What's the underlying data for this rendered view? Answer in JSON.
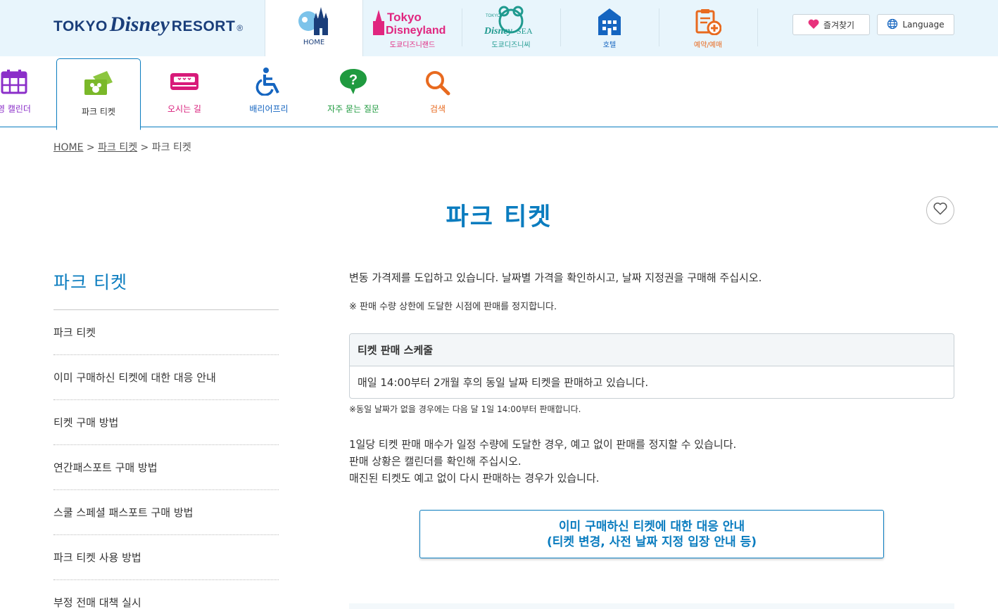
{
  "header": {
    "logo": {
      "part1": "TOKYO",
      "part2": "Disney",
      "part3": "RESORT",
      "reg": "®"
    },
    "park_tabs": [
      {
        "id": "home",
        "label": "HOME",
        "color": "#1a3e7a"
      },
      {
        "id": "land",
        "label": "도쿄디즈니랜드",
        "logo_lines": [
          "Tokyo",
          "Disneyland"
        ],
        "color": "#e0267f"
      },
      {
        "id": "sea",
        "label": "도쿄디즈니씨",
        "logo_small": "TOKYO",
        "logo_lines": [
          "Disney",
          "SEA"
        ],
        "color": "#1f9a8f"
      },
      {
        "id": "hotel",
        "label": "호텔",
        "color": "#1565c0"
      },
      {
        "id": "reserve",
        "label": "예약/예매",
        "color": "#e86a1f"
      }
    ],
    "favorites_label": "즐겨찾기",
    "language_label": "Language"
  },
  "subnav": {
    "items": [
      {
        "id": "calendar",
        "label": "영 캘린더",
        "color": "#8b2fc9"
      },
      {
        "id": "tickets",
        "label": "파크 티켓",
        "color": "#333333"
      },
      {
        "id": "access",
        "label": "오시는 길",
        "color": "#d81b7a"
      },
      {
        "id": "barrierfree",
        "label": "배리어프리",
        "color": "#1565c0"
      },
      {
        "id": "faq",
        "label": "자주 묻는 질문",
        "color": "#1f9a3f"
      },
      {
        "id": "search",
        "label": "검색",
        "color": "#e86a1f"
      }
    ]
  },
  "breadcrumb": {
    "home": "HOME",
    "sep1": " > ",
    "tickets": "파크 티켓",
    "sep2": " > ",
    "current": "파크 티켓"
  },
  "page_title": "파크 티켓",
  "sidebar": {
    "title": "파크 티켓",
    "items": [
      "파크 티켓",
      "이미 구매하신 티켓에 대한 대응 안내",
      "티켓 구매 방법",
      "연간패스포트 구매 방법",
      "스쿨 스페셜 패스포트 구매 방법",
      "파크 티켓 사용 방법",
      "부정 전매 대책 실시"
    ]
  },
  "main": {
    "intro": "변동 가격제를 도입하고 있습니다. 날짜별 가격을 확인하시고, 날짜 지정권을 구매해 주십시오.",
    "note1": "※ 판매 수량 상한에 도달한 시점에 판매를 정지합니다.",
    "schedule": {
      "heading": "티켓 판매 스케줄",
      "body": "매일 14:00부터 2개월 후의 동일 날짜 티켓을 판매하고 있습니다."
    },
    "note2": "※동일 날짜가 없을 경우에는 다음 달 1일 14:00부터 판매합니다.",
    "para_lines": [
      "1일당 티켓 판매 매수가 일정 수량에 도달한 경우, 예고 없이 판매를 정지할 수 있습니다.",
      "판매 상황은 캘린더를 확인해 주십시오.",
      "매진된 티켓도 예고 없이 다시 판매하는 경우가 있습니다."
    ],
    "cta_line1": "이미 구매하신 티켓에 대한 대응 안내",
    "cta_line2": "(티켓 변경, 사전 날짜 지정 입장 안내 등)"
  },
  "colors": {
    "accent": "#0a7cbf",
    "header_bg": "#e8f5fc"
  }
}
